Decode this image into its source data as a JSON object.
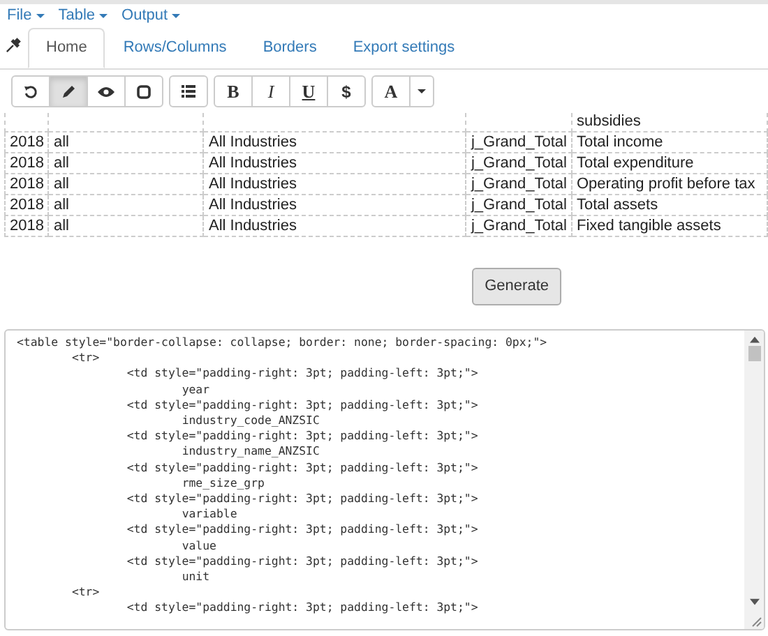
{
  "menu": [
    {
      "label": "File"
    },
    {
      "label": "Table"
    },
    {
      "label": "Output"
    }
  ],
  "tabs": [
    {
      "label": "Home",
      "selected": true
    },
    {
      "label": "Rows/Columns",
      "selected": false
    },
    {
      "label": "Borders",
      "selected": false
    },
    {
      "label": "Export settings",
      "selected": false
    }
  ],
  "toolbar": [
    [
      {
        "kind": "undo",
        "selected": false
      },
      {
        "kind": "pencil",
        "selected": true
      },
      {
        "kind": "eye",
        "selected": false
      },
      {
        "kind": "square",
        "selected": false
      }
    ],
    [
      {
        "kind": "list",
        "selected": false
      }
    ],
    [
      {
        "kind": "bold",
        "label": "B",
        "selected": false
      },
      {
        "kind": "italic",
        "label": "I",
        "selected": false
      },
      {
        "kind": "underline",
        "label": "U",
        "selected": false
      },
      {
        "kind": "currency",
        "label": "$",
        "selected": false
      }
    ],
    [
      {
        "kind": "font",
        "label": "A",
        "selected": false
      },
      {
        "kind": "caret",
        "selected": false
      }
    ]
  ],
  "table": {
    "rows": [
      [
        "",
        "",
        "",
        "",
        "subsidies"
      ],
      [
        "2018",
        "all",
        "All Industries",
        "j_Grand_Total",
        "Total income"
      ],
      [
        "2018",
        "all",
        "All Industries",
        "j_Grand_Total",
        "Total expenditure"
      ],
      [
        "2018",
        "all",
        "All Industries",
        "j_Grand_Total",
        "Operating profit before tax"
      ],
      [
        "2018",
        "all",
        "All Industries",
        "j_Grand_Total",
        "Total assets"
      ],
      [
        "2018",
        "all",
        "All Industries",
        "j_Grand_Total",
        "Fixed tangible assets"
      ]
    ]
  },
  "generate_button": "Generate",
  "output_code": "<table style=\"border-collapse: collapse; border: none; border-spacing: 0px;\">\n\t<tr>\n\t\t<td style=\"padding-right: 3pt; padding-left: 3pt;\">\n\t\t\tyear\n\t\t<td style=\"padding-right: 3pt; padding-left: 3pt;\">\n\t\t\tindustry_code_ANZSIC\n\t\t<td style=\"padding-right: 3pt; padding-left: 3pt;\">\n\t\t\tindustry_name_ANZSIC\n\t\t<td style=\"padding-right: 3pt; padding-left: 3pt;\">\n\t\t\trme_size_grp\n\t\t<td style=\"padding-right: 3pt; padding-left: 3pt;\">\n\t\t\tvariable\n\t\t<td style=\"padding-right: 3pt; padding-left: 3pt;\">\n\t\t\tvalue\n\t\t<td style=\"padding-right: 3pt; padding-left: 3pt;\">\n\t\t\tunit\n\t<tr>\n\t\t<td style=\"padding-right: 3pt; padding-left: 3pt;\">"
}
